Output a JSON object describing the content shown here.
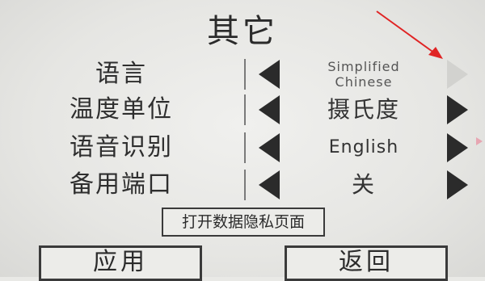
{
  "title": "其它",
  "settings": [
    {
      "label": "语言",
      "value": "Simplified Chinese",
      "value_lines": [
        "Simplified",
        "Chinese"
      ]
    },
    {
      "label": "温度单位",
      "value": "摄氏度"
    },
    {
      "label": "语音识别",
      "value": "English"
    },
    {
      "label": "备用端口",
      "value": "关"
    }
  ],
  "buttons": {
    "privacy": "打开数据隐私页面",
    "apply": "应用",
    "back": "返回"
  },
  "colors": {
    "background": "#e9e9e6",
    "text": "#2b2b2b",
    "annotation_arrow": "#e02424"
  }
}
